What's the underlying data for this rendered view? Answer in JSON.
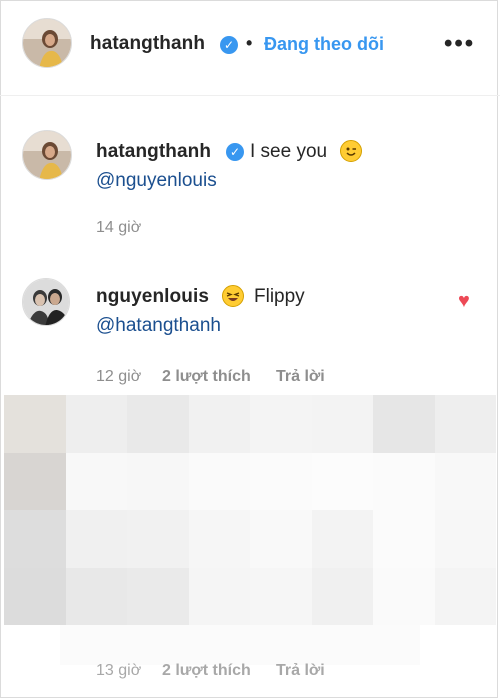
{
  "header": {
    "username": "hatangthanh",
    "separator": "•",
    "follow_status": "Đang theo dõi",
    "more_icon": "more-horizontal-icon"
  },
  "comments": [
    {
      "username": "hatangthanh",
      "text": "I see you",
      "emoji": "winking-face",
      "mention": "@nguyenlouis",
      "time": "14 giờ"
    },
    {
      "username": "nguyenlouis",
      "text": "Flippy",
      "emoji": "laughing-face",
      "mention": "@hatangthanh",
      "time": "12 giờ",
      "likes": "2 lượt thích",
      "reply": "Trả lời",
      "liked_icon": "heart-filled-icon"
    }
  ],
  "partial_footer": {
    "time": "13 giờ",
    "likes": "2 lượt thích",
    "reply": "Trả lời"
  },
  "colors": {
    "link_blue": "#3897f0",
    "mention_blue": "#1b4f8f",
    "meta_gray": "#8e8e8e",
    "heart_red": "#ed4956"
  }
}
